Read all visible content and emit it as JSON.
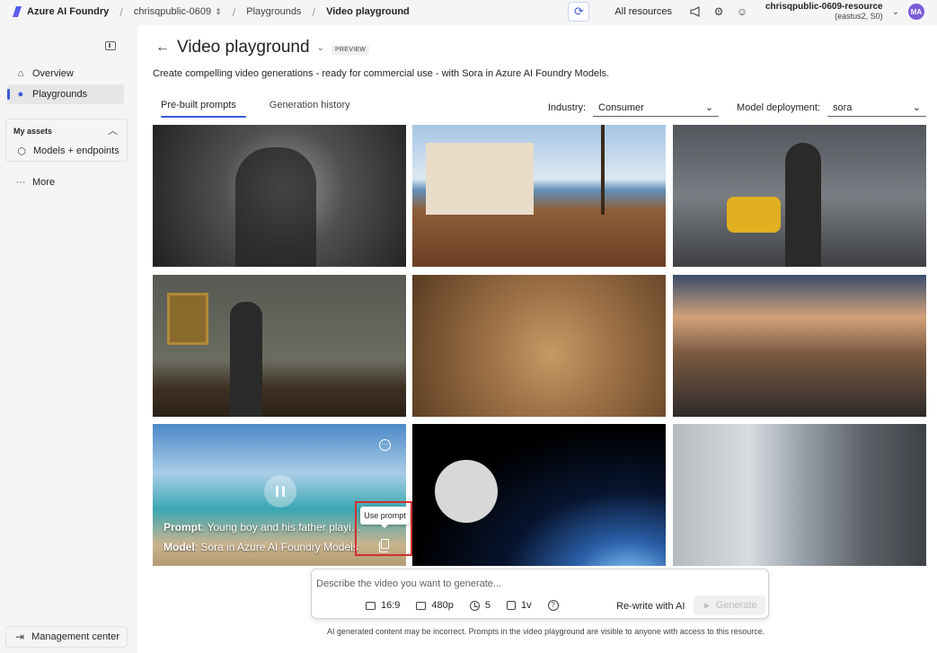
{
  "topbar": {
    "brand": "Azure AI Foundry",
    "breadcrumbs": [
      "chrisqpublic-0609",
      "Playgrounds",
      "Video playground"
    ],
    "all_resources": "All resources",
    "resource_name": "chrisqpublic-0609-resource",
    "resource_region": "(eastus2, S0)",
    "avatar_initials": "MA"
  },
  "sidebar": {
    "overview": "Overview",
    "playgrounds": "Playgrounds",
    "my_assets": "My assets",
    "models_endpoints": "Models + endpoints",
    "more": "More",
    "management_center": "Management center"
  },
  "main": {
    "title": "Video playground",
    "preview_badge": "PREVIEW",
    "subtitle": "Create compelling video generations - ready for commercial use - with Sora in Azure AI Foundry Models.",
    "tabs": [
      {
        "label": "Pre-built prompts"
      },
      {
        "label": "Generation history"
      }
    ],
    "industry_label": "Industry:",
    "industry_value": "Consumer",
    "model_label": "Model deployment:",
    "model_value": "sora",
    "hover_card": {
      "prompt_label": "Prompt",
      "prompt_text": ": Young boy and his father playi...",
      "model_label": "Model",
      "model_text": ": Sora in Azure AI Foundry Models",
      "tooltip": "Use prompt"
    }
  },
  "prompt_box": {
    "placeholder": "Describe the video you want to generate...",
    "aspect": "16:9",
    "resolution": "480p",
    "duration": "5",
    "variants": "1v",
    "rewrite": "Re-write with AI",
    "generate": "Generate"
  },
  "disclaimer": "AI generated content may be incorrect. Prompts in the video playground are visible to anyone with access to this resource."
}
